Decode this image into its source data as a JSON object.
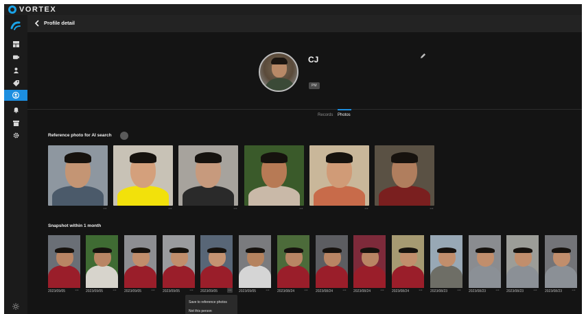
{
  "app": {
    "brand": "VORTEX"
  },
  "header": {
    "title": "Profile detail"
  },
  "profile": {
    "name": "CJ",
    "role": "PM"
  },
  "tabs": [
    {
      "label": "Records"
    },
    {
      "label": "Photos"
    }
  ],
  "reference_section": {
    "title": "Reference photo for AI search"
  },
  "snapshot_section": {
    "title": "Snapshot within 1 month"
  },
  "reference_photos": [
    {
      "bg": "#8e97a0",
      "skin": "#c49574",
      "shirt": "#4b5a6a"
    },
    {
      "bg": "#c8c2b6",
      "skin": "#d4a07c",
      "shirt": "#f2e10b"
    },
    {
      "bg": "#a7a39d",
      "skin": "#c79a7d",
      "shirt": "#2a2a2a"
    },
    {
      "bg": "#3a5a2a",
      "skin": "#b77a55",
      "shirt": "#c9b9a8"
    },
    {
      "bg": "#c9b79a",
      "skin": "#d09b77",
      "shirt": "#c86b4a"
    },
    {
      "bg": "#5a5144",
      "skin": "#b07e5e",
      "shirt": "#7a1f1f"
    }
  ],
  "snapshots": [
    {
      "date": "2023/09/05",
      "bg": "#6a6f76",
      "skin": "#b98564",
      "shirt": "#9a1e2a"
    },
    {
      "date": "2023/09/05",
      "bg": "#3f6b33",
      "skin": "#b98564",
      "shirt": "#d7d4cc"
    },
    {
      "date": "2023/09/05",
      "bg": "#8d8e92",
      "skin": "#c18e6c",
      "shirt": "#9a1e2a"
    },
    {
      "date": "2023/09/05",
      "bg": "#9a9b9e",
      "skin": "#c18e6c",
      "shirt": "#9a1e2a"
    },
    {
      "date": "2023/09/05",
      "bg": "#586677",
      "skin": "#c59372",
      "shirt": "#9a1e2a"
    },
    {
      "date": "2023/09/05",
      "bg": "#7a7b7e",
      "skin": "#b5835f",
      "shirt": "#d5d5d5"
    },
    {
      "date": "2023/08/24",
      "bg": "#4c6b3a",
      "skin": "#b98564",
      "shirt": "#9a1e2a"
    },
    {
      "date": "2023/08/24",
      "bg": "#5c5d61",
      "skin": "#b98564",
      "shirt": "#9a1e2a"
    },
    {
      "date": "2023/08/24",
      "bg": "#7d2a3a",
      "skin": "#b98564",
      "shirt": "#9a1e2a"
    },
    {
      "date": "2023/08/24",
      "bg": "#a69a72",
      "skin": "#c18e6c",
      "shirt": "#9a1e2a"
    },
    {
      "date": "2023/08/23",
      "bg": "#98a8b5",
      "skin": "#c18e6c",
      "shirt": "#6e6e66"
    },
    {
      "date": "2023/08/23",
      "bg": "#8a8c90",
      "skin": "#c18e6c",
      "shirt": "#8b9096"
    },
    {
      "date": "2023/08/23",
      "bg": "#9c9d98",
      "skin": "#c18e6c",
      "shirt": "#8b9096"
    },
    {
      "date": "2023/08/23",
      "bg": "#737478",
      "skin": "#c18e6c",
      "shirt": "#8b9096"
    }
  ],
  "context_menu": {
    "items": [
      {
        "label": "Save to reference photos"
      },
      {
        "label": "Not this person"
      }
    ]
  },
  "more_label": "···",
  "colors": {
    "accent": "#1c8ee0",
    "background": "#141414"
  }
}
